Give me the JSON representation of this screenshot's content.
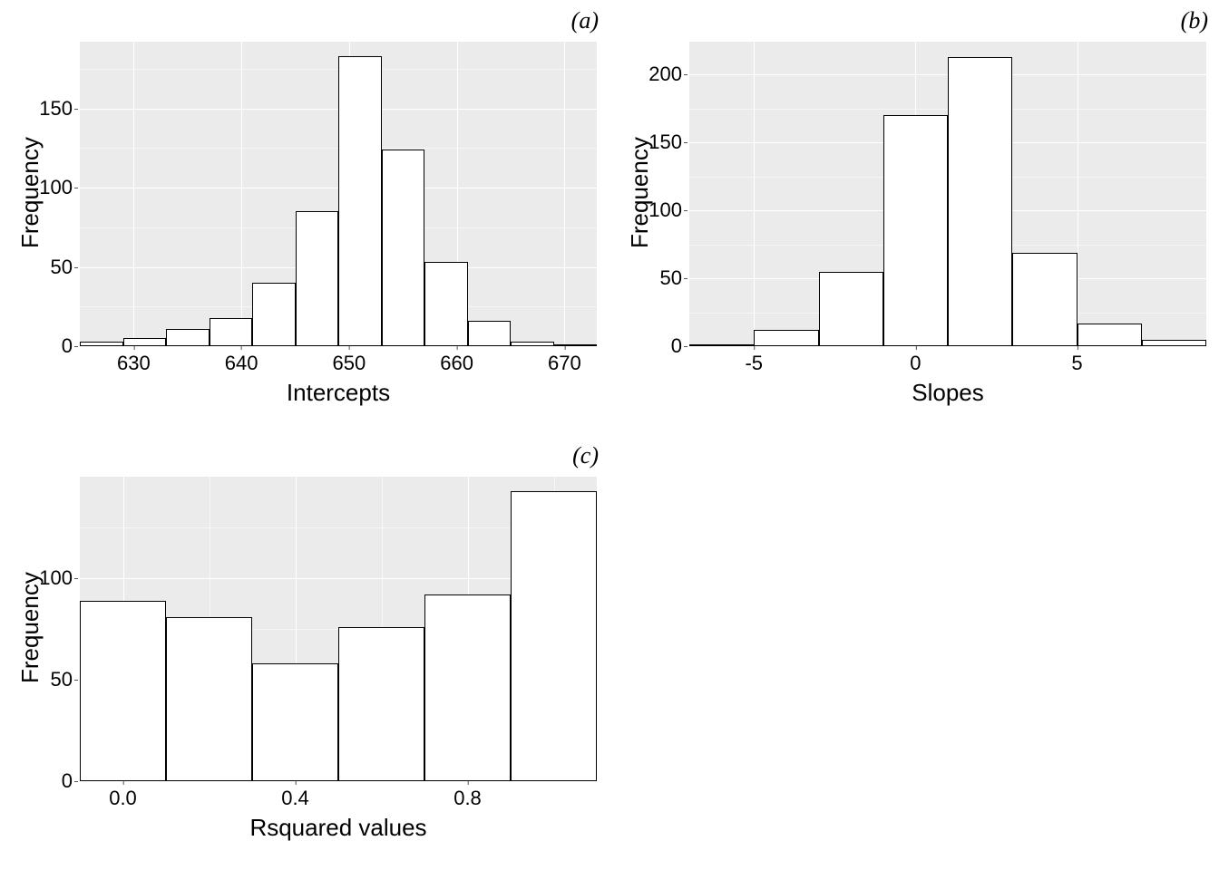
{
  "chart_data": [
    {
      "id": "a",
      "type": "bar",
      "title": "(a)",
      "xlabel": "Intercepts",
      "ylabel": "Frequency",
      "bin_width": 4,
      "bin_start": 625,
      "categories": [
        627,
        631,
        635,
        639,
        643,
        647,
        651,
        655,
        659,
        663,
        667,
        671
      ],
      "values": [
        3,
        5,
        11,
        18,
        40,
        85,
        183,
        124,
        53,
        16,
        3,
        1
      ],
      "xlim": [
        625,
        673
      ],
      "ylim": [
        0,
        192
      ],
      "x_ticks": [
        630,
        640,
        650,
        660,
        670
      ],
      "y_ticks": [
        0,
        50,
        100,
        150
      ],
      "y_minor": [
        25,
        75,
        125,
        175
      ]
    },
    {
      "id": "b",
      "type": "bar",
      "title": "(b)",
      "xlabel": "Slopes",
      "ylabel": "Frequency",
      "bin_width": 2,
      "bin_start": -7,
      "categories": [
        -6,
        -4,
        -2,
        0,
        2,
        4,
        6,
        8
      ],
      "values": [
        1,
        12,
        55,
        170,
        213,
        69,
        17,
        5
      ],
      "xlim": [
        -7,
        9
      ],
      "ylim": [
        0,
        224
      ],
      "x_ticks": [
        -5,
        0,
        5
      ],
      "y_ticks": [
        0,
        50,
        100,
        150,
        200
      ],
      "y_minor": [
        25,
        75,
        125,
        175
      ]
    },
    {
      "id": "c",
      "type": "bar",
      "title": "(c)",
      "xlabel": "Rsquared values",
      "ylabel": "Frequency",
      "bin_width": 0.2,
      "bin_start": -0.1,
      "categories": [
        0.0,
        0.2,
        0.4,
        0.6,
        0.8,
        1.0
      ],
      "values": [
        89,
        81,
        58,
        76,
        92,
        143
      ],
      "xlim": [
        -0.1,
        1.1
      ],
      "ylim": [
        0,
        150
      ],
      "x_ticks": [
        0.0,
        0.4,
        0.8
      ],
      "x_tick_labels": [
        "0.0",
        "0.4",
        "0.8"
      ],
      "y_ticks": [
        0,
        50,
        100
      ],
      "y_minor": [
        25,
        75,
        125
      ],
      "x_minor": [
        0.2,
        0.6,
        1.0
      ]
    }
  ]
}
